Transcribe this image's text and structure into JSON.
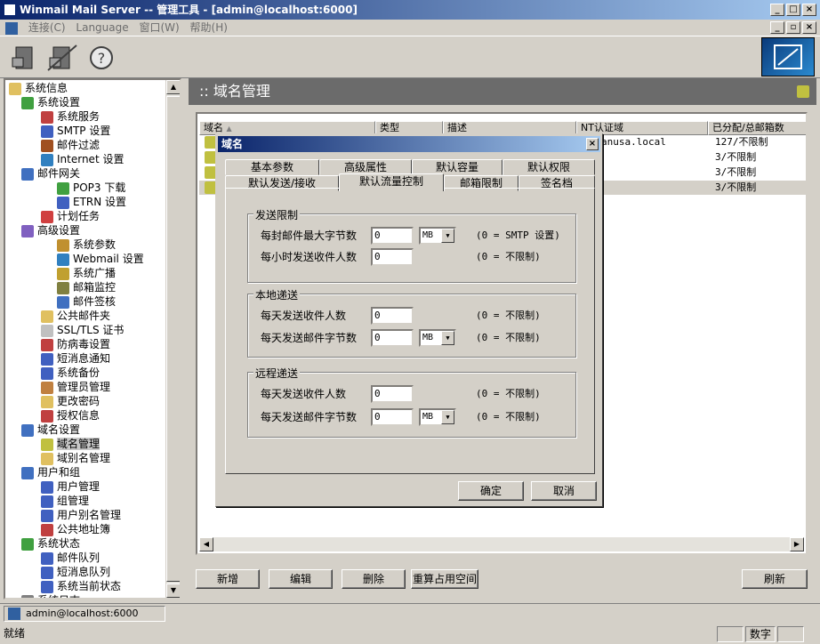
{
  "window": {
    "title": "Winmail Mail Server -- 管理工具 - [admin@localhost:6000]"
  },
  "menu": {
    "items": [
      "连接(C)",
      "Language",
      "窗口(W)",
      "帮助(H)"
    ]
  },
  "tree": {
    "items": [
      {
        "label": "系统信息",
        "indent": 0,
        "color": "#e0c060"
      },
      {
        "label": "系统设置",
        "indent": 1,
        "color": "#40a040"
      },
      {
        "label": "系统服务",
        "indent": 2,
        "color": "#c04040"
      },
      {
        "label": "SMTP 设置",
        "indent": 2,
        "color": "#4060c0"
      },
      {
        "label": "邮件过滤",
        "indent": 2,
        "color": "#a05020"
      },
      {
        "label": "Internet 设置",
        "indent": 2,
        "color": "#3080c0"
      },
      {
        "label": "邮件网关",
        "indent": 1,
        "color": "#4070c0"
      },
      {
        "label": "POP3 下载",
        "indent": 3,
        "color": "#40a040"
      },
      {
        "label": "ETRN 设置",
        "indent": 3,
        "color": "#4060c0"
      },
      {
        "label": "计划任务",
        "indent": 2,
        "color": "#d04040"
      },
      {
        "label": "高级设置",
        "indent": 1,
        "color": "#8060c0"
      },
      {
        "label": "系统参数",
        "indent": 3,
        "color": "#c09030"
      },
      {
        "label": "Webmail 设置",
        "indent": 3,
        "color": "#3080c0"
      },
      {
        "label": "系统广播",
        "indent": 3,
        "color": "#c0a030"
      },
      {
        "label": "邮箱监控",
        "indent": 3,
        "color": "#808040"
      },
      {
        "label": "邮件签核",
        "indent": 3,
        "color": "#4070c0"
      },
      {
        "label": "公共邮件夹",
        "indent": 2,
        "color": "#e0c060"
      },
      {
        "label": "SSL/TLS 证书",
        "indent": 2,
        "color": "#c0c0c0"
      },
      {
        "label": "防病毒设置",
        "indent": 2,
        "color": "#c04040"
      },
      {
        "label": "短消息通知",
        "indent": 2,
        "color": "#4060c0"
      },
      {
        "label": "系统备份",
        "indent": 2,
        "color": "#4060c0"
      },
      {
        "label": "管理员管理",
        "indent": 2,
        "color": "#c08040"
      },
      {
        "label": "更改密码",
        "indent": 2,
        "color": "#e0c060"
      },
      {
        "label": "授权信息",
        "indent": 2,
        "color": "#c04040"
      },
      {
        "label": "域名设置",
        "indent": 1,
        "color": "#4070c0"
      },
      {
        "label": "域名管理",
        "indent": 2,
        "color": "#c0c040",
        "selected": true
      },
      {
        "label": "域别名管理",
        "indent": 2,
        "color": "#e0c060"
      },
      {
        "label": "用户和组",
        "indent": 1,
        "color": "#4070c0"
      },
      {
        "label": "用户管理",
        "indent": 2,
        "color": "#4060c0"
      },
      {
        "label": "组管理",
        "indent": 2,
        "color": "#4060c0"
      },
      {
        "label": "用户别名管理",
        "indent": 2,
        "color": "#4060c0"
      },
      {
        "label": "公共地址簿",
        "indent": 2,
        "color": "#c04040"
      },
      {
        "label": "系统状态",
        "indent": 1,
        "color": "#40a040"
      },
      {
        "label": "邮件队列",
        "indent": 2,
        "color": "#4060c0"
      },
      {
        "label": "短消息队列",
        "indent": 2,
        "color": "#4060c0"
      },
      {
        "label": "系统当前状态",
        "indent": 2,
        "color": "#4060c0"
      },
      {
        "label": "系统日志",
        "indent": 1,
        "color": "#808080"
      }
    ]
  },
  "main": {
    "header": ":: 域名管理",
    "columns": [
      "域名",
      "类型",
      "描述",
      "NT认证域",
      "已分配/总邮箱数"
    ],
    "rows": [
      {
        "nt": "anusa.local",
        "alloc": "127/不限制"
      },
      {
        "nt": "",
        "alloc": "3/不限制"
      },
      {
        "nt": "",
        "alloc": "3/不限制"
      },
      {
        "nt": "",
        "alloc": "3/不限制"
      }
    ],
    "buttons": {
      "add": "新增",
      "edit": "编辑",
      "delete": "删除",
      "recalc": "重算占用空间",
      "refresh": "刷新"
    }
  },
  "dialog": {
    "title": "域名",
    "tabs_row1": [
      "基本参数",
      "高级属性",
      "默认容量",
      "默认权限"
    ],
    "tabs_row2": [
      "默认发送/接收",
      "默认流量控制",
      "邮箱限制",
      "签名档"
    ],
    "send": {
      "title": "发送限制",
      "max_bytes_label": "每封邮件最大字节数",
      "max_bytes_value": "0",
      "max_bytes_unit": "MB",
      "max_bytes_hint": "(0 = SMTP 设置)",
      "rcpt_hour_label": "每小时发送收件人数",
      "rcpt_hour_value": "0",
      "rcpt_hour_hint": "(0 = 不限制)"
    },
    "local": {
      "title": "本地递送",
      "rcpt_label": "每天发送收件人数",
      "rcpt_value": "0",
      "rcpt_hint": "(0 = 不限制)",
      "bytes_label": "每天发送邮件字节数",
      "bytes_value": "0",
      "bytes_unit": "MB",
      "bytes_hint": "(0 = 不限制)"
    },
    "remote": {
      "title": "远程递送",
      "rcpt_label": "每天发送收件人数",
      "rcpt_value": "0",
      "rcpt_hint": "(0 = 不限制)",
      "bytes_label": "每天发送邮件字节数",
      "bytes_value": "0",
      "bytes_unit": "MB",
      "bytes_hint": "(0 = 不限制)"
    },
    "ok": "确定",
    "cancel": "取消"
  },
  "status": {
    "connection": "admin@localhost:6000",
    "ready": "就绪",
    "numlock": "数字"
  }
}
